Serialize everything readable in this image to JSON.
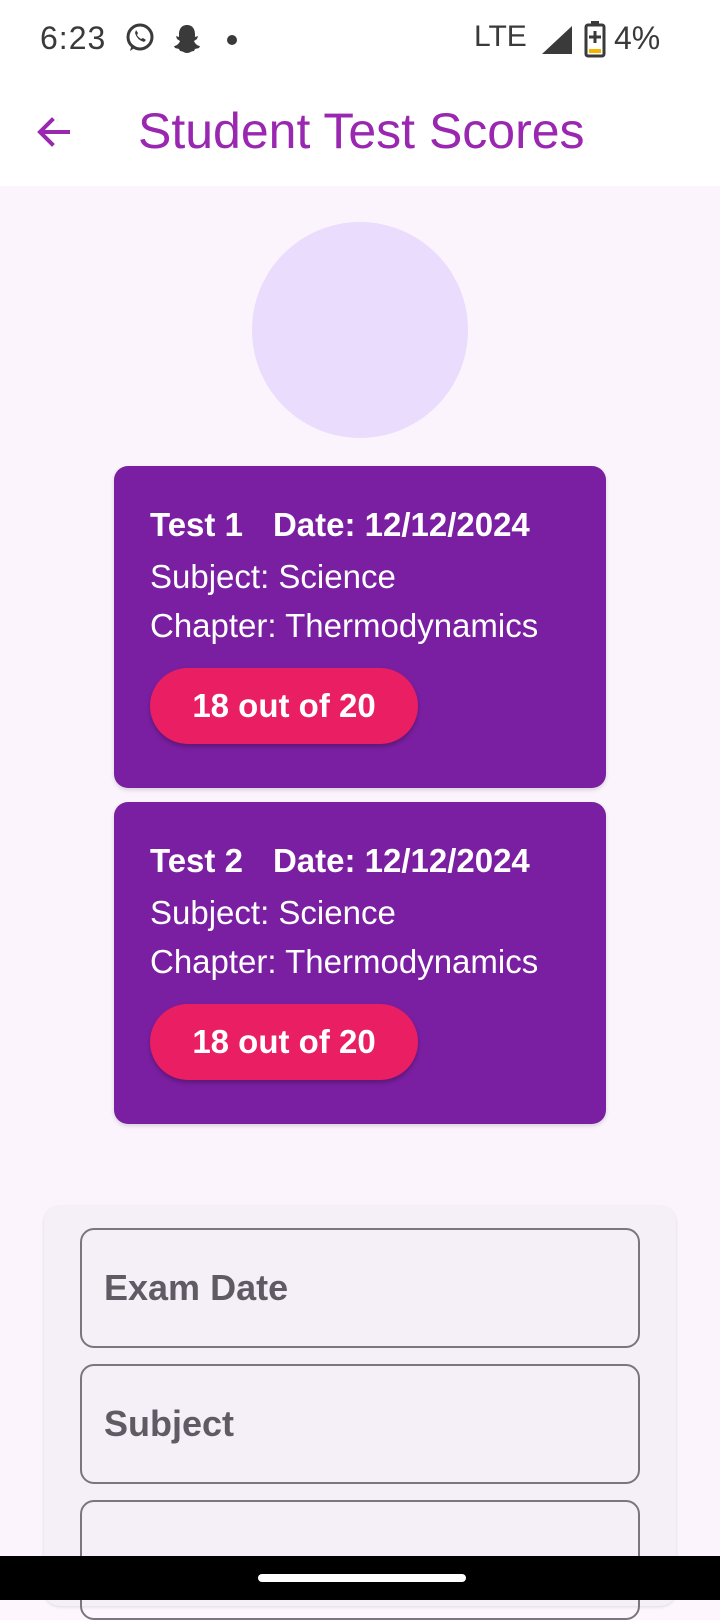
{
  "status_bar": {
    "time": "6:23",
    "network": "LTE",
    "battery": "4%",
    "icons": [
      "whatsapp-icon",
      "snapchat-icon",
      "dot-icon",
      "signal-icon",
      "battery-icon"
    ]
  },
  "app_bar": {
    "back_icon": "arrow-back-icon",
    "title": "Student Test Scores"
  },
  "tests": [
    {
      "test": "Test 1",
      "date": "Date: 12/12/2024",
      "subject": "Subject: Science",
      "chapter": "Chapter: Thermodynamics",
      "score": "18 out of 20"
    },
    {
      "test": "Test 2",
      "date": "Date: 12/12/2024",
      "subject": "Subject: Science",
      "chapter": "Chapter: Thermodynamics",
      "score": "18 out of 20"
    }
  ],
  "form": {
    "exam_date_placeholder": "Exam Date",
    "subject_placeholder": "Subject"
  },
  "colors": {
    "accent": "#9a27b0",
    "card": "#7b1fa2",
    "score_pill": "#e91e63",
    "avatar": "#eadcfd"
  }
}
